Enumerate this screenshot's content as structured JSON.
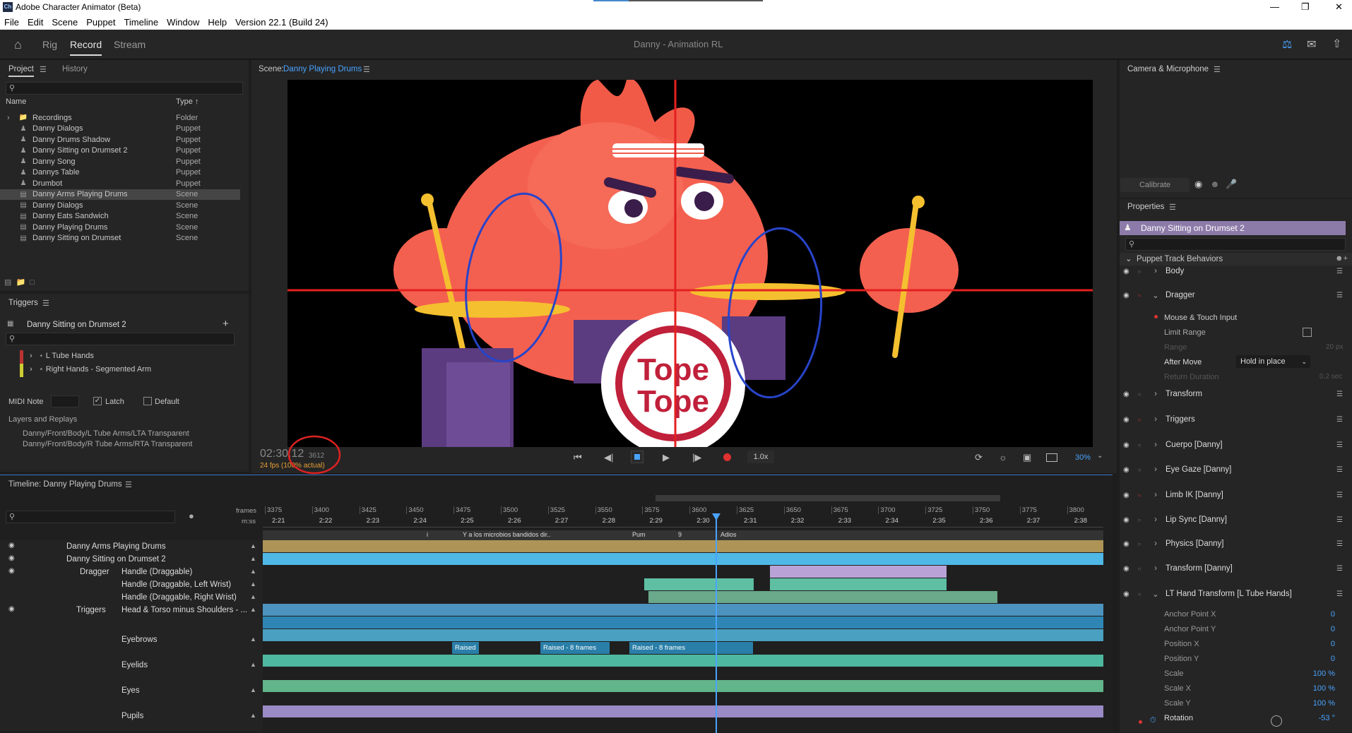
{
  "window": {
    "title": "Adobe Character Animator (Beta)",
    "logo": "Ch"
  },
  "menu": [
    "File",
    "Edit",
    "Scene",
    "Puppet",
    "Timeline",
    "Window",
    "Help",
    "Version 22.1 (Build 24)"
  ],
  "header": {
    "tabs": [
      "Rig",
      "Record",
      "Stream"
    ],
    "active_tab": "Record",
    "title": "Danny - Animation RL"
  },
  "project": {
    "tabs": [
      "Project",
      "History"
    ],
    "col_name": "Name",
    "col_type": "Type",
    "items": [
      {
        "name": "Recordings",
        "type": "Folder",
        "icon": "folder-icon"
      },
      {
        "name": "Danny Dialogs",
        "type": "Puppet",
        "icon": "puppet-icon"
      },
      {
        "name": "Danny Drums Shadow",
        "type": "Puppet",
        "icon": "puppet-icon"
      },
      {
        "name": "Danny Sitting on Drumset 2",
        "type": "Puppet",
        "icon": "puppet-icon"
      },
      {
        "name": "Danny Song",
        "type": "Puppet",
        "icon": "puppet-icon"
      },
      {
        "name": "Dannys Table",
        "type": "Puppet",
        "icon": "puppet-icon"
      },
      {
        "name": "Drumbot",
        "type": "Puppet",
        "icon": "puppet-icon"
      },
      {
        "name": "Danny Arms Playing Drums",
        "type": "Scene",
        "icon": "scene-icon"
      },
      {
        "name": "Danny Dialogs",
        "type": "Scene",
        "icon": "scene-icon"
      },
      {
        "name": "Danny Eats Sandwich",
        "type": "Scene",
        "icon": "scene-icon"
      },
      {
        "name": "Danny Playing Drums",
        "type": "Scene",
        "icon": "scene-icon"
      },
      {
        "name": "Danny Sitting on Drumset",
        "type": "Scene",
        "icon": "scene-icon"
      }
    ]
  },
  "triggers": {
    "title": "Triggers",
    "puppet": "Danny Sitting on Drumset 2",
    "items": [
      "L Tube Hands",
      "Right Hands - Segmented Arm"
    ],
    "midi_label": "MIDI Note",
    "latch": "Latch",
    "default": "Default",
    "layers_label": "Layers and Replays",
    "layers": [
      "Danny/Front/Body/L Tube Arms/LTA Transparent",
      "Danny/Front/Body/R Tube Arms/RTA Transparent"
    ]
  },
  "scene": {
    "label": "Scene:",
    "name": "Danny Playing Drums"
  },
  "transport": {
    "timecode": "02:30:12",
    "frame": "3612",
    "fps": "24 fps (100% actual)",
    "speed": "1.0x",
    "zoom": "30%"
  },
  "timeline": {
    "title": "Timeline: Danny Playing Drums",
    "frames_label": "frames",
    "mss_label": "m:ss",
    "frame_ticks": [
      "3375",
      "3400",
      "3425",
      "3450",
      "3475",
      "3500",
      "3525",
      "3550",
      "3575",
      "3600",
      "3625",
      "3650",
      "3675",
      "3700",
      "3725",
      "3750",
      "3775",
      "3800"
    ],
    "time_ticks": [
      "2:21",
      "2:22",
      "2:23",
      "2:24",
      "2:25",
      "2:26",
      "2:27",
      "2:28",
      "2:29",
      "2:30",
      "2:31",
      "2:32",
      "2:33",
      "2:34",
      "2:35",
      "2:36",
      "2:37",
      "2:38"
    ],
    "markers": [
      "i",
      "Y a los microbios bandidos dir..",
      "Pum",
      "9",
      "Adios"
    ],
    "tracks": [
      {
        "label": "Danny Arms Playing Drums",
        "indent": 0
      },
      {
        "label": "Danny Sitting on Drumset 2",
        "indent": 0
      },
      {
        "label": "Dragger",
        "sub": "Handle (Draggable)"
      },
      {
        "label": "",
        "sub": "Handle (Draggable, Left Wrist)"
      },
      {
        "label": "",
        "sub": "Handle (Draggable, Right Wrist)"
      },
      {
        "label": "Triggers",
        "sub": "Head & Torso minus Shoulders - ..."
      },
      {
        "label": "",
        "sub": "Eyebrows"
      },
      {
        "label": "",
        "sub": "Eyelids"
      },
      {
        "label": "",
        "sub": "Eyes"
      },
      {
        "label": "",
        "sub": "Pupils"
      }
    ],
    "clips": [
      "Raised",
      "Raised - 8 frames",
      "Raised - 8 frames"
    ]
  },
  "camera": {
    "title": "Camera & Microphone",
    "calibrate": "Calibrate"
  },
  "properties": {
    "title": "Properties",
    "puppet": "Danny Sitting on Drumset 2",
    "section": "Puppet Track Behaviors",
    "behaviors": [
      "Body",
      "Dragger",
      "Transform",
      "Triggers",
      "Cuerpo [Danny]",
      "Eye Gaze [Danny]",
      "Limb IK [Danny]",
      "Lip Sync [Danny]",
      "Physics [Danny]",
      "Transform [Danny]",
      "LT Hand Transform [L Tube Hands]"
    ],
    "dragger_sub": {
      "mouse": "Mouse & Touch Input",
      "limit": "Limit Range",
      "range": "Range",
      "range_val": "20 px",
      "after_move": "After Move",
      "after_move_val": "Hold in place",
      "return": "Return Duration",
      "return_val": "0.2 sec"
    },
    "lt_params": [
      {
        "name": "Anchor Point X",
        "value": "0"
      },
      {
        "name": "Anchor Point Y",
        "value": "0"
      },
      {
        "name": "Position X",
        "value": "0"
      },
      {
        "name": "Position Y",
        "value": "0"
      },
      {
        "name": "Scale",
        "value": "100 %"
      },
      {
        "name": "Scale X",
        "value": "100 %"
      },
      {
        "name": "Scale Y",
        "value": "100 %"
      },
      {
        "name": "Rotation",
        "value": "-53 °"
      }
    ]
  },
  "stage_logo": {
    "line1": "Tope",
    "line2": "Tope"
  }
}
